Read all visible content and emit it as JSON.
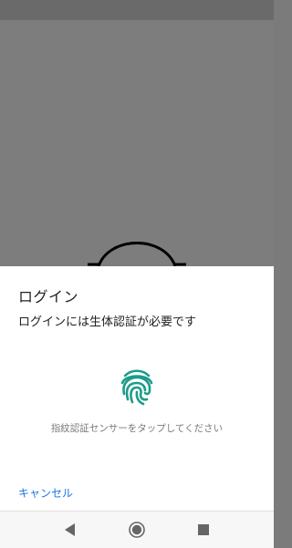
{
  "dialog": {
    "title": "ログイン",
    "subtitle": "ログインには生体認証が必要です",
    "hint": "指紋認証センサーをタップしてください",
    "cancel_label": "キャンセル"
  },
  "icons": {
    "fingerprint": "fingerprint-icon",
    "back": "back-triangle-icon",
    "home": "home-circle-icon",
    "recent": "recent-square-icon"
  },
  "colors": {
    "accent": "#1a73e8",
    "fingerprint": "#1b9c8a",
    "scrim": "#7b7b7b"
  }
}
